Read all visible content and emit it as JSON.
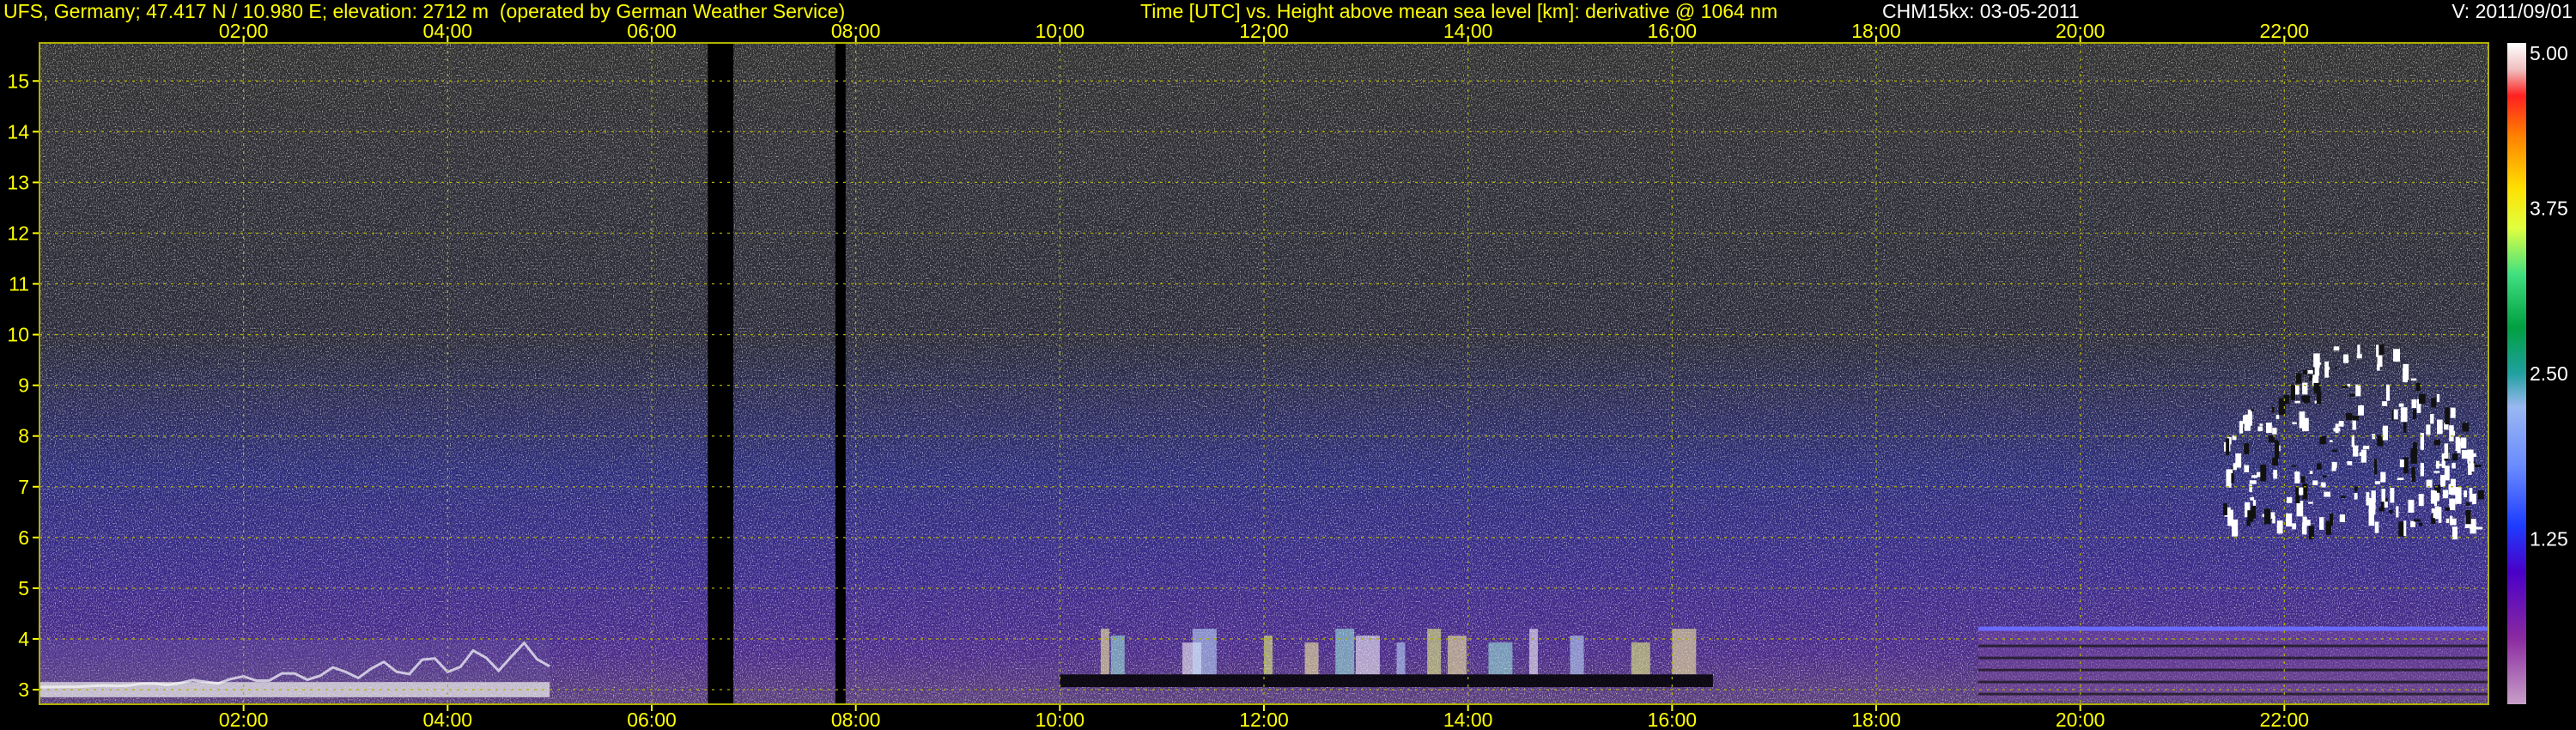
{
  "header": {
    "site": "UFS, Germany; 47.417 N / 10.980 E; elevation: 2712 m  (operated by German Weather Service)",
    "title": "Time [UTC] vs. Height above mean sea level [km]: derivative @ 1064 nm",
    "instrument": "CHM15kx: 03-05-2011",
    "version": "V: 2011/09/01"
  },
  "colors": {
    "background": "#000000",
    "header_text": "#ffff00",
    "header_meta_text": "#ffffff",
    "axis_labels": "#ffff00",
    "grid": "#b0b000"
  },
  "chart_data": {
    "type": "heatmap",
    "title": "Time [UTC] vs. Height above mean sea level [km]: derivative @ 1064 nm",
    "xlabel": "Time [UTC]",
    "ylabel": "Height above mean sea level [km]",
    "x_unit": "hours UTC",
    "xlim": [
      0,
      24
    ],
    "ylim": [
      2.712,
      15.75
    ],
    "x_ticks": [
      "02:00",
      "04:00",
      "06:00",
      "08:00",
      "10:00",
      "12:00",
      "14:00",
      "16:00",
      "18:00",
      "20:00",
      "22:00"
    ],
    "y_ticks": [
      "3",
      "4",
      "5",
      "6",
      "7",
      "8",
      "9",
      "10",
      "11",
      "12",
      "13",
      "14",
      "15"
    ],
    "grid": true,
    "colorbar": {
      "range": [
        0,
        5
      ],
      "tick_labels": [
        "5.00",
        "3.75",
        "2.50",
        "1.25"
      ]
    },
    "data_gaps": [
      {
        "start": 6.55,
        "end": 6.8
      },
      {
        "start": 7.8,
        "end": 7.9
      }
    ],
    "features": [
      {
        "kind": "boundary-layer aerosol",
        "time_start": 0.0,
        "time_end": 5.0,
        "height_top": 4.0
      },
      {
        "kind": "enhanced backscatter columns",
        "time_start": 10.2,
        "time_end": 16.2,
        "height_top": 4.2
      },
      {
        "kind": "cloud",
        "time_start": 21.4,
        "time_end": 23.9,
        "height_base": 6.2,
        "height_top": 10.0
      },
      {
        "kind": "aerosol layer top",
        "time_start": 19.0,
        "time_end": 24.0,
        "height_top": 4.2
      }
    ]
  }
}
